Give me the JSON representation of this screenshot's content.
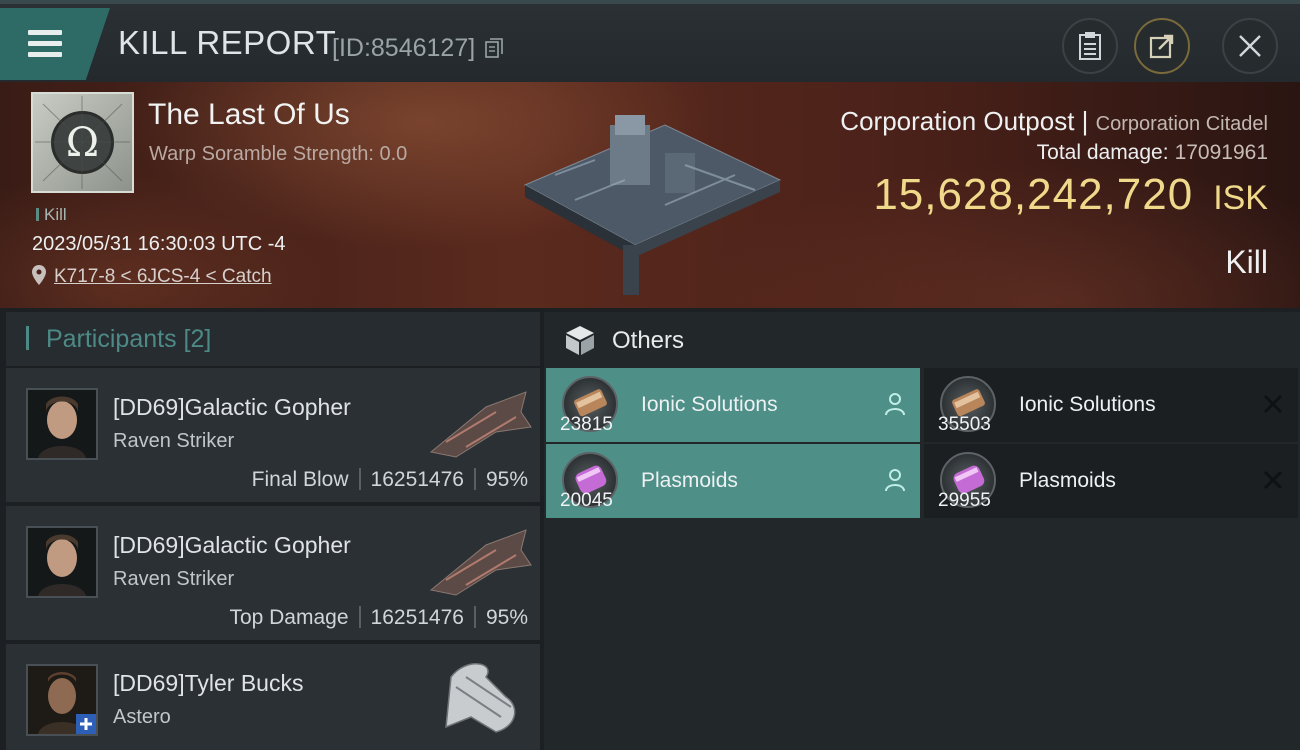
{
  "header": {
    "title": "KILL REPORT",
    "report_id": "[ID:8546127]",
    "icons": [
      "menu-icon",
      "copy-icon",
      "clipboard-icon",
      "share-icon",
      "close-icon"
    ]
  },
  "victim": {
    "name": "The Last Of Us",
    "warp_scramble": "Warp Soramble Strength: 0.0",
    "tag": "Kill",
    "datetime": "2023/05/31 16:30:03 UTC -4",
    "location": "K717-8 < 6JCS-4 < Catch"
  },
  "structure": {
    "type": "Corporation Outpost",
    "separator": "|",
    "subtype": "Corporation Citadel",
    "total_damage_label": "Total damage:",
    "total_damage": "17091961",
    "isk_value": "15,628,242,720",
    "isk_unit": "ISK",
    "result": "Kill"
  },
  "participants": {
    "title": "Participants",
    "count": "[2]",
    "rows": [
      {
        "name": "[DD69]Galactic Gopher",
        "ship": "Raven Striker",
        "role": "Final Blow",
        "damage": "16251476",
        "percent": "95%"
      },
      {
        "name": "[DD69]Galactic Gopher",
        "ship": "Raven Striker",
        "role": "Top Damage",
        "damage": "16251476",
        "percent": "95%"
      },
      {
        "name": "[DD69]Tyler Bucks",
        "ship": "Astero",
        "role": "",
        "damage": "",
        "percent": ""
      }
    ]
  },
  "others": {
    "title": "Others",
    "items": [
      {
        "name": "Ionic Solutions",
        "qty": "23815",
        "state": "dropped"
      },
      {
        "name": "Ionic Solutions",
        "qty": "35503",
        "state": "destroyed"
      },
      {
        "name": "Plasmoids",
        "qty": "20045",
        "state": "dropped"
      },
      {
        "name": "Plasmoids",
        "qty": "29955",
        "state": "destroyed"
      }
    ]
  },
  "colors": {
    "accent_teal": "#4e8f88",
    "isk_gold": "#f0d98a",
    "banner_red": "#5b2a1e"
  }
}
